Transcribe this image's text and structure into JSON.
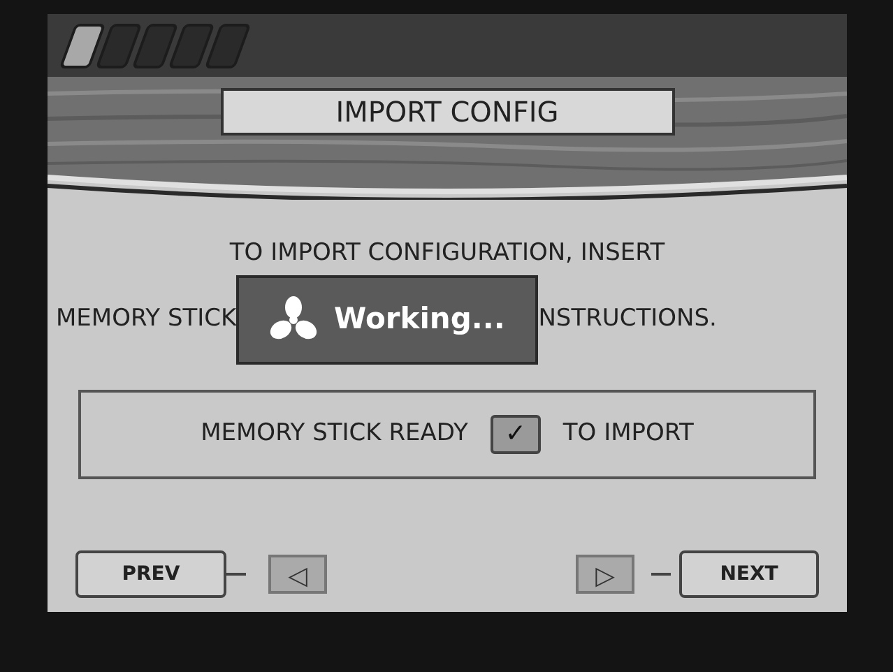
{
  "progress_steps": [
    {
      "done": true
    },
    {
      "done": false
    },
    {
      "done": false
    },
    {
      "done": false
    },
    {
      "done": false
    }
  ],
  "title": "IMPORT CONFIG",
  "instructions": {
    "line_1": "TO IMPORT CONFIGURATION, INSERT",
    "line_2_left": "MEMORY STICK",
    "line_2_right": "NSTRUCTIONS."
  },
  "working_dialog": {
    "text": "Working..."
  },
  "ready_option": {
    "label": "MEMORY STICK READY",
    "checked": true,
    "suffix": "TO IMPORT",
    "check_mark": "✓"
  },
  "navigation": {
    "prev": {
      "label": "PREV",
      "arrow": "◁"
    },
    "next": {
      "label": "NEXT",
      "arrow": "▷"
    }
  }
}
